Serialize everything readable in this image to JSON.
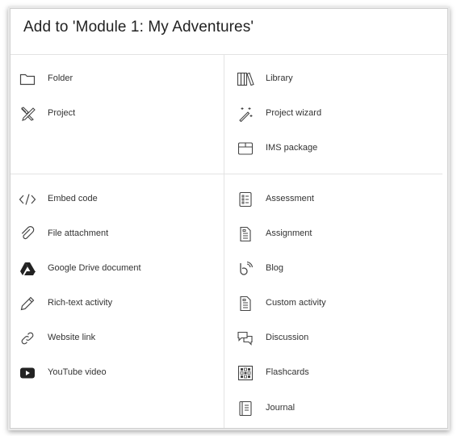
{
  "dialog": {
    "title": "Add to 'Module 1: My Adventures'"
  },
  "left_top": [
    {
      "label": "Folder",
      "icon": "folder-icon"
    },
    {
      "label": "Project",
      "icon": "project-icon"
    }
  ],
  "right_top": [
    {
      "label": "Library",
      "icon": "library-icon"
    },
    {
      "label": "Project wizard",
      "icon": "wand-icon"
    },
    {
      "label": "IMS package",
      "icon": "package-icon"
    }
  ],
  "left_bottom": [
    {
      "label": "Embed code",
      "icon": "code-icon"
    },
    {
      "label": "File attachment",
      "icon": "paperclip-icon"
    },
    {
      "label": "Google Drive document",
      "icon": "google-drive-icon"
    },
    {
      "label": "Rich-text activity",
      "icon": "pencil-icon"
    },
    {
      "label": "Website link",
      "icon": "link-icon"
    },
    {
      "label": "YouTube video",
      "icon": "youtube-icon"
    }
  ],
  "right_bottom": [
    {
      "label": "Assessment",
      "icon": "checklist-icon"
    },
    {
      "label": "Assignment",
      "icon": "document-icon"
    },
    {
      "label": "Blog",
      "icon": "blog-icon"
    },
    {
      "label": "Custom activity",
      "icon": "document-icon"
    },
    {
      "label": "Discussion",
      "icon": "chat-icon"
    },
    {
      "label": "Flashcards",
      "icon": "flashcards-icon"
    },
    {
      "label": "Journal",
      "icon": "journal-icon"
    }
  ]
}
